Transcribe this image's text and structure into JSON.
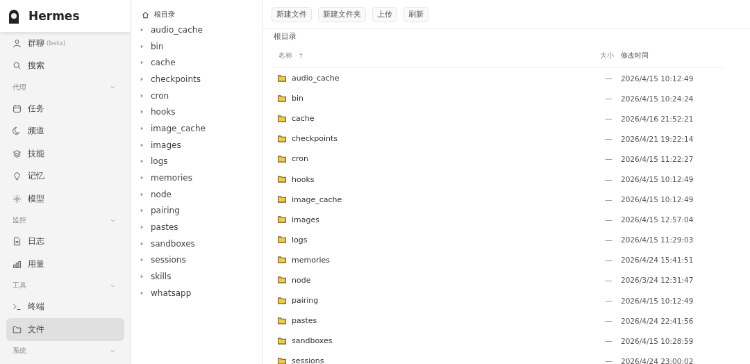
{
  "app": {
    "title": "Hermes"
  },
  "sidebar": {
    "items": [
      {
        "kind": "item",
        "label": "群聊",
        "tag": "(beta)",
        "selected": false
      },
      {
        "kind": "item",
        "label": "搜索",
        "selected": false
      },
      {
        "kind": "section",
        "label": "代理",
        "expanded": true
      },
      {
        "kind": "item",
        "label": "任务",
        "selected": false
      },
      {
        "kind": "item",
        "label": "频道",
        "selected": false
      },
      {
        "kind": "item",
        "label": "技能",
        "selected": false
      },
      {
        "kind": "item",
        "label": "记忆",
        "selected": false
      },
      {
        "kind": "item",
        "label": "模型",
        "selected": false
      },
      {
        "kind": "section",
        "label": "监控",
        "expanded": true
      },
      {
        "kind": "item",
        "label": "日志",
        "selected": false
      },
      {
        "kind": "item",
        "label": "用量",
        "selected": false
      },
      {
        "kind": "section",
        "label": "工具",
        "expanded": true
      },
      {
        "kind": "item",
        "label": "终端",
        "selected": false
      },
      {
        "kind": "item",
        "label": "文件",
        "selected": true
      },
      {
        "kind": "section",
        "label": "系统",
        "expanded": true
      }
    ]
  },
  "tree": {
    "root": "根目录",
    "items": [
      {
        "label": "audio_cache",
        "expanded": false
      },
      {
        "label": "bin",
        "expanded": false
      },
      {
        "label": "cache",
        "expanded": false
      },
      {
        "label": "checkpoints",
        "expanded": false
      },
      {
        "label": "cron",
        "expanded": false
      },
      {
        "label": "hooks",
        "expanded": false
      },
      {
        "label": "image_cache",
        "expanded": false
      },
      {
        "label": "images",
        "expanded": false
      },
      {
        "label": "logs",
        "expanded": false
      },
      {
        "label": "memories",
        "expanded": false
      },
      {
        "label": "node",
        "expanded": false
      },
      {
        "label": "pairing",
        "expanded": false
      },
      {
        "label": "pastes",
        "expanded": false
      },
      {
        "label": "sandboxes",
        "expanded": false
      },
      {
        "label": "sessions",
        "expanded": false
      },
      {
        "label": "skills",
        "expanded": false
      },
      {
        "label": "whatsapp",
        "expanded": false
      }
    ]
  },
  "toolbar": {
    "buttons": [
      "新建文件",
      "新建文件夹",
      "上传",
      "刷新"
    ]
  },
  "breadcrumb": "根目录",
  "table": {
    "columns": [
      {
        "label": "名称",
        "sort_mark": "↑"
      },
      {
        "label": "大小"
      },
      {
        "label": "修改时间"
      }
    ],
    "rows": [
      {
        "name": "audio_cache",
        "size": "—",
        "modified": "2026/4/15 10:12:49"
      },
      {
        "name": "bin",
        "size": "—",
        "modified": "2026/4/15 10:24:24"
      },
      {
        "name": "cache",
        "size": "—",
        "modified": "2026/4/16 21:52:21"
      },
      {
        "name": "checkpoints",
        "size": "—",
        "modified": "2026/4/21 19:22:14"
      },
      {
        "name": "cron",
        "size": "—",
        "modified": "2026/4/15 11:22:27"
      },
      {
        "name": "hooks",
        "size": "—",
        "modified": "2026/4/15 10:12:49"
      },
      {
        "name": "image_cache",
        "size": "—",
        "modified": "2026/4/15 10:12:49"
      },
      {
        "name": "images",
        "size": "—",
        "modified": "2026/4/15 12:57:04"
      },
      {
        "name": "logs",
        "size": "—",
        "modified": "2026/4/15 11:29:03"
      },
      {
        "name": "memories",
        "size": "—",
        "modified": "2026/4/24 15:41:51"
      },
      {
        "name": "node",
        "size": "—",
        "modified": "2026/3/24 12:31:47"
      },
      {
        "name": "pairing",
        "size": "—",
        "modified": "2026/4/15 10:12:49"
      },
      {
        "name": "pastes",
        "size": "—",
        "modified": "2026/4/24 22:41:56"
      },
      {
        "name": "sandboxes",
        "size": "—",
        "modified": "2026/4/15 10:28:59"
      },
      {
        "name": "sessions",
        "size": "—",
        "modified": "2026/4/24 23:00:02"
      }
    ]
  }
}
